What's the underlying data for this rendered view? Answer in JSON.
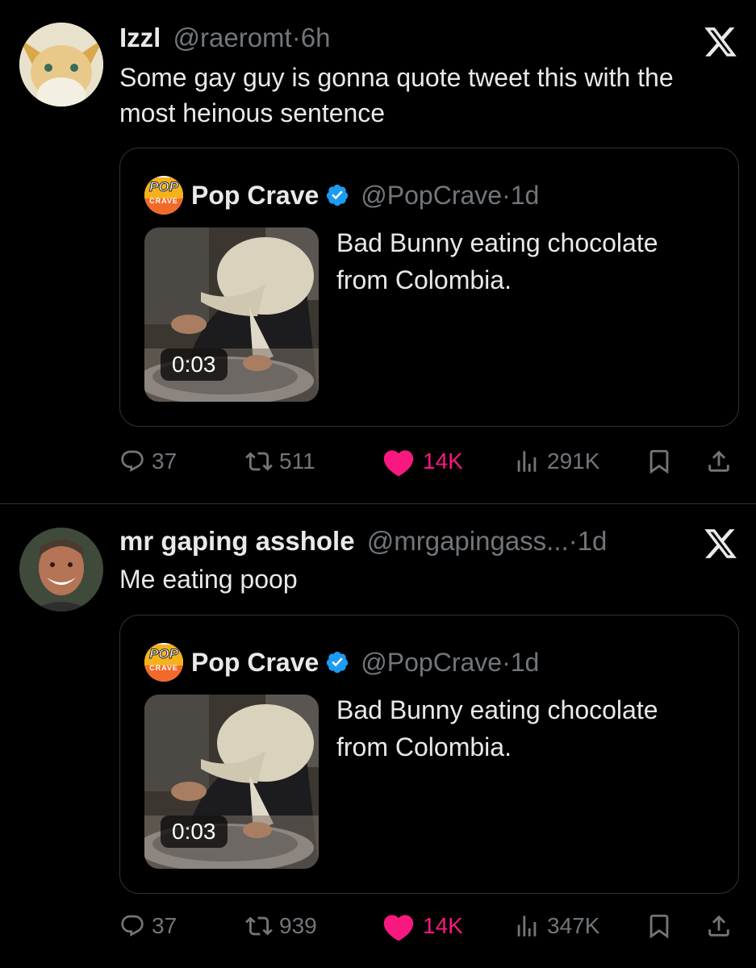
{
  "tweets": [
    {
      "author_name": "Izzl",
      "handle": "@raeromt",
      "sep": "·",
      "time": "6h",
      "text": "Some gay guy is gonna quote tweet this with the most heinous sentence",
      "quote": {
        "logo_top": "POP",
        "logo_bottom": "CRAVE",
        "name": "Pop Crave",
        "handle": "@PopCrave",
        "sep": "·",
        "time": "1d",
        "text": "Bad Bunny eating chocolate from Colombia.",
        "duration": "0:03"
      },
      "stats": {
        "replies": "37",
        "reposts": "511",
        "likes": "14K",
        "views": "291K"
      }
    },
    {
      "author_name": "mr gaping asshole",
      "handle": "@mrgapingass...",
      "sep": "·",
      "time": "1d",
      "text": "Me eating poop",
      "quote": {
        "logo_top": "POP",
        "logo_bottom": "CRAVE",
        "name": "Pop Crave",
        "handle": "@PopCrave",
        "sep": "·",
        "time": "1d",
        "text": "Bad Bunny eating chocolate from Colombia.",
        "duration": "0:03"
      },
      "stats": {
        "replies": "37",
        "reposts": "939",
        "likes": "14K",
        "views": "347K"
      }
    }
  ],
  "colors": {
    "background": "#000000",
    "muted": "#71767b",
    "like": "#f91880",
    "verified": "#1d9bf0",
    "border": "#2f3336"
  },
  "icons": [
    "x-logo-icon",
    "verified-badge-icon",
    "reply-icon",
    "repost-icon",
    "heart-icon",
    "views-icon",
    "bookmark-icon",
    "share-icon"
  ]
}
